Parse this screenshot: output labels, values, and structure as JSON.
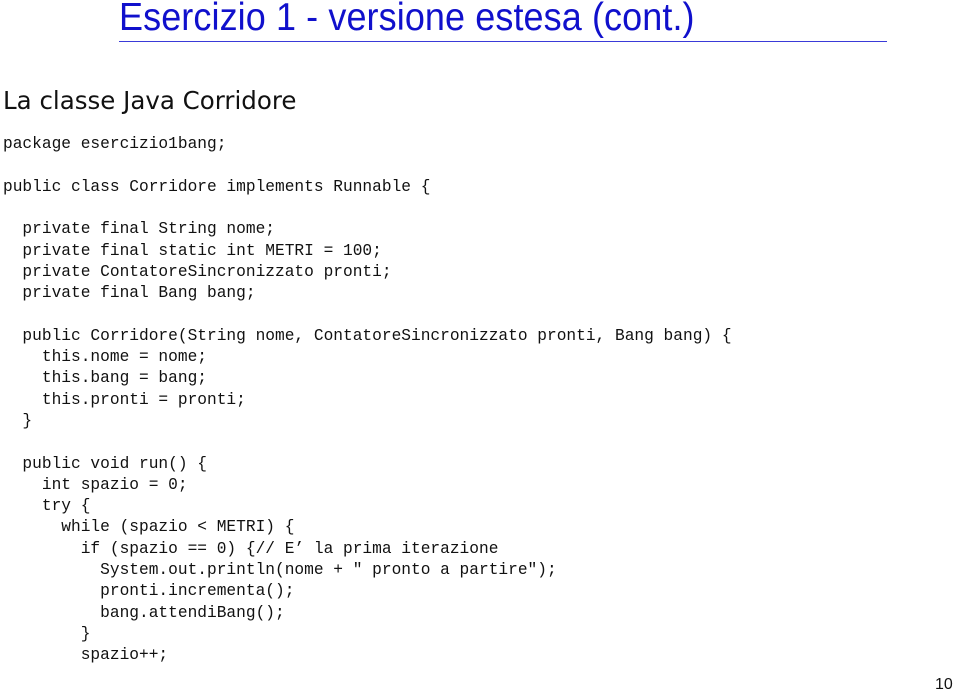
{
  "slide": {
    "title": "Esercizio 1 - versione estesa (cont.)",
    "heading": "La classe Java Corridore",
    "page_number": "10",
    "accent_color": "#1010cc"
  },
  "code": {
    "language": "java",
    "lines": [
      "package esercizio1bang;",
      "",
      "public class Corridore implements Runnable {",
      "",
      "  private final String nome;",
      "  private final static int METRI = 100;",
      "  private ContatoreSincronizzato pronti;",
      "  private final Bang bang;",
      "",
      "  public Corridore(String nome, ContatoreSincronizzato pronti, Bang bang) {",
      "    this.nome = nome;",
      "    this.bang = bang;",
      "    this.pronti = pronti;",
      "  }",
      "",
      "  public void run() {",
      "    int spazio = 0;",
      "    try {",
      "      while (spazio < METRI) {",
      "        if (spazio == 0) {// E’ la prima iterazione",
      "          System.out.println(nome + \" pronto a partire\");",
      "          pronti.incrementa();",
      "          bang.attendiBang();",
      "        }",
      "        spazio++;"
    ]
  }
}
